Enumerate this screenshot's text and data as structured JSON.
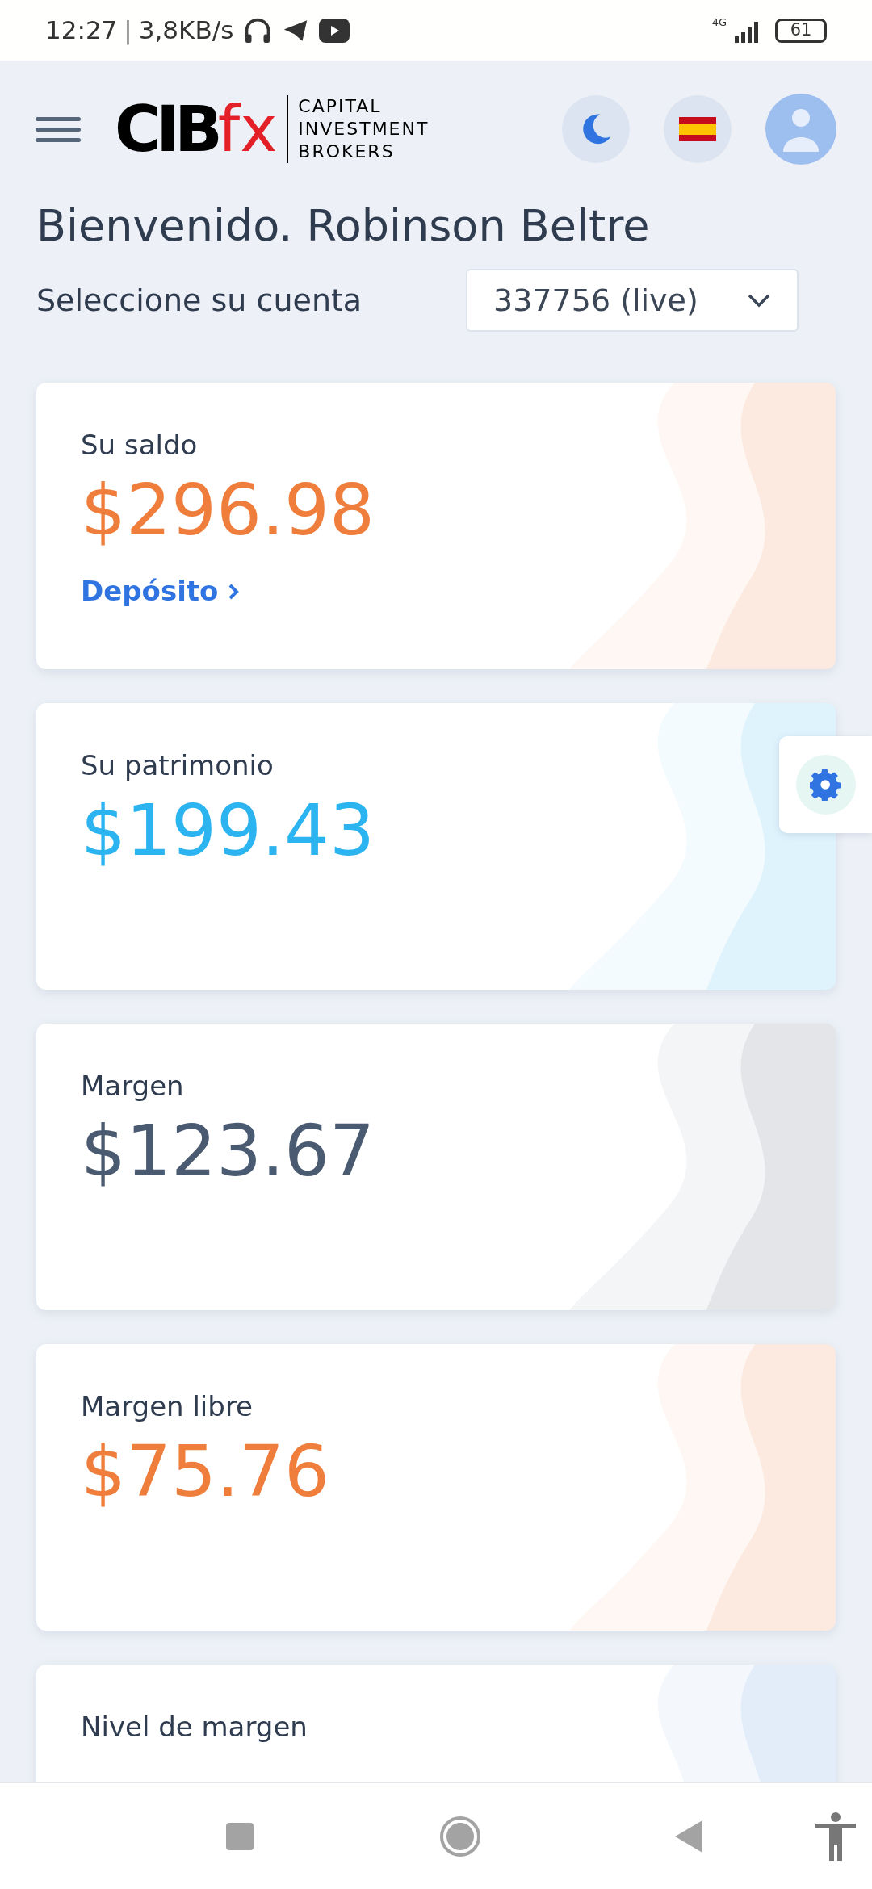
{
  "status_bar": {
    "time": "12:27",
    "separator": "|",
    "speed": "3,8KB/s",
    "network": "4G",
    "battery": "61"
  },
  "header": {
    "logo_main": "CIB",
    "logo_accent": "fx",
    "logo_tagline": [
      "CAPITAL",
      "INVESTMENT",
      "BROKERS"
    ]
  },
  "welcome": "Bienvenido. Robinson Beltre",
  "account": {
    "label": "Seleccione su cuenta",
    "value": "337756 (live)"
  },
  "cards": [
    {
      "label": "Su saldo",
      "value": "$296.98",
      "color": "#ef7d3b",
      "link": "Depósito"
    },
    {
      "label": "Su patrimonio",
      "value": "$199.43",
      "color": "#2bb4ef"
    },
    {
      "label": "Margen",
      "value": "$123.67",
      "color": "#4a5a70"
    },
    {
      "label": "Margen libre",
      "value": "$75.76",
      "color": "#ef7d3b"
    },
    {
      "label": "Nivel de margen"
    }
  ]
}
